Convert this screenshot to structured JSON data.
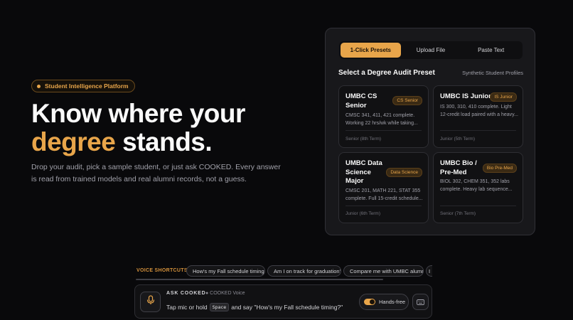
{
  "hero": {
    "badge": "Student Intelligence Platform",
    "title_line1": "Know where your",
    "title_accent": "degree",
    "title_rest": " stands.",
    "subtitle": "Drop your audit, pick a sample student, or just ask COOKED. Every answer is read from trained models and real alumni records, not a guess."
  },
  "panel": {
    "tabs": [
      "1-Click Presets",
      "Upload File",
      "Paste Text"
    ],
    "active_tab": 0,
    "title": "Select a Degree Audit Preset",
    "link": "Synthetic Student Profiles",
    "cards": [
      {
        "name": "UMBC CS Senior",
        "tag": "CS Senior",
        "desc": "CMSC 341, 411, 421 complete. Working 22 hrs/wk while taking...",
        "term": "Senior (8th Term)"
      },
      {
        "name": "UMBC IS Junior",
        "tag": "IS Junior",
        "desc": "IS 300, 310, 410 complete. Light 12-credit load paired with a heavy...",
        "term": "Junior (5th Term)"
      },
      {
        "name": "UMBC Data Science Major",
        "tag": "Data Science",
        "desc": "CMSC 201, MATH 221, STAT 355 complete. Full 15-credit schedule...",
        "term": "Junior (6th Term)"
      },
      {
        "name": "UMBC Bio / Pre-Med",
        "tag": "Bio Pre-Med",
        "desc": "BIOL 302, CHEM 351, 352 labs complete. Heavy lab sequence...",
        "term": "Senior (7th Term)"
      }
    ]
  },
  "voice": {
    "label": "VOICE SHORTCUTS:",
    "chips": [
      "How's my Fall schedule timing?",
      "Am I on track for graduation?",
      "Compare me with UMBC alumni",
      "I"
    ]
  },
  "ask": {
    "label": "ASK COOKED",
    "sub": "● COOKED Voice",
    "hint_pre": "Tap mic or hold",
    "hint_key": "Space",
    "hint_post": "and say \"How's my Fall schedule timing?\"",
    "hands_free": "Hands-free"
  },
  "colors": {
    "accent": "#e8a54a",
    "background": "#09090b",
    "card": "#111113"
  },
  "icons": {
    "mic": "microphone-icon",
    "keyboard": "keyboard-icon"
  }
}
